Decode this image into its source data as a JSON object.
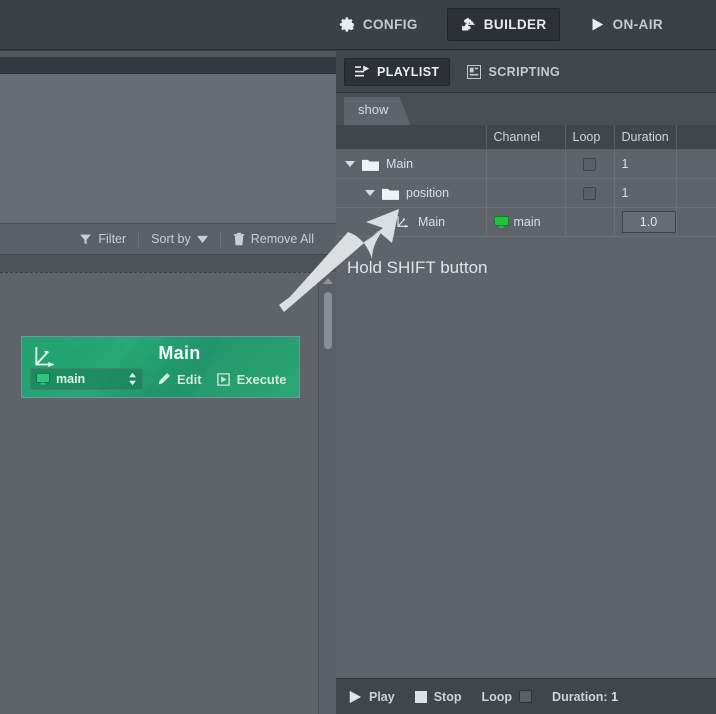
{
  "topbar": {
    "items": [
      {
        "label": "CONFIG",
        "icon": "gear-icon",
        "active": false
      },
      {
        "label": "BUILDER",
        "icon": "puzzle-icon",
        "active": true
      },
      {
        "label": "ON-AIR",
        "icon": "play-icon",
        "active": false
      }
    ]
  },
  "left_panel": {
    "toolbar": {
      "filter_label": "Filter",
      "filter_icon": "funnel-icon",
      "sort_label": "Sort by",
      "sort_icon": "chevron-down-icon",
      "remove_all_label": "Remove All",
      "remove_all_icon": "trash-icon"
    },
    "card": {
      "title": "Main",
      "icon": "axis-transform-icon",
      "channel_value": "main",
      "channel_icon": "monitor-icon",
      "edit_label": "Edit",
      "edit_icon": "pencil-icon",
      "execute_label": "Execute",
      "execute_icon": "execute-icon",
      "accent_color": "#28a271",
      "border_color": "#6f93a8"
    }
  },
  "right_panel": {
    "tabs": [
      {
        "label": "PLAYLIST",
        "icon": "playlist-icon",
        "active": true
      },
      {
        "label": "SCRIPTING",
        "icon": "script-icon",
        "active": false
      }
    ],
    "show_tab": {
      "label": "show"
    },
    "table": {
      "headers": [
        "",
        "Channel",
        "Loop",
        "Duration",
        ""
      ],
      "rows": [
        {
          "name": "Main",
          "indent": 0,
          "icon": "folder-icon",
          "caret": "caret-down-icon",
          "channel": "",
          "loop": "unchecked",
          "duration": "1",
          "duration_boxed": false
        },
        {
          "name": "position",
          "indent": 1,
          "icon": "folder-icon",
          "caret": "caret-down-icon",
          "channel": "",
          "loop": "unchecked",
          "duration": "1",
          "duration_boxed": false
        },
        {
          "name": "Main",
          "indent": 2,
          "icon": "axis-transform-icon",
          "caret": "",
          "channel": "main",
          "channel_icon": "monitor-icon",
          "loop": "",
          "duration": "1.0",
          "duration_boxed": true
        }
      ]
    },
    "hint": "Hold SHIFT button",
    "bottom_bar": {
      "play_label": "Play",
      "play_icon": "play-icon",
      "stop_label": "Stop",
      "stop_icon": "stop-icon",
      "loop_label": "Loop",
      "loop_checked": "unchecked",
      "duration_label": "Duration:",
      "duration_value": "1"
    }
  },
  "annotation": {
    "arrow": "pointer-arrow-up-right",
    "arrow_color": "#dcdfe2"
  }
}
